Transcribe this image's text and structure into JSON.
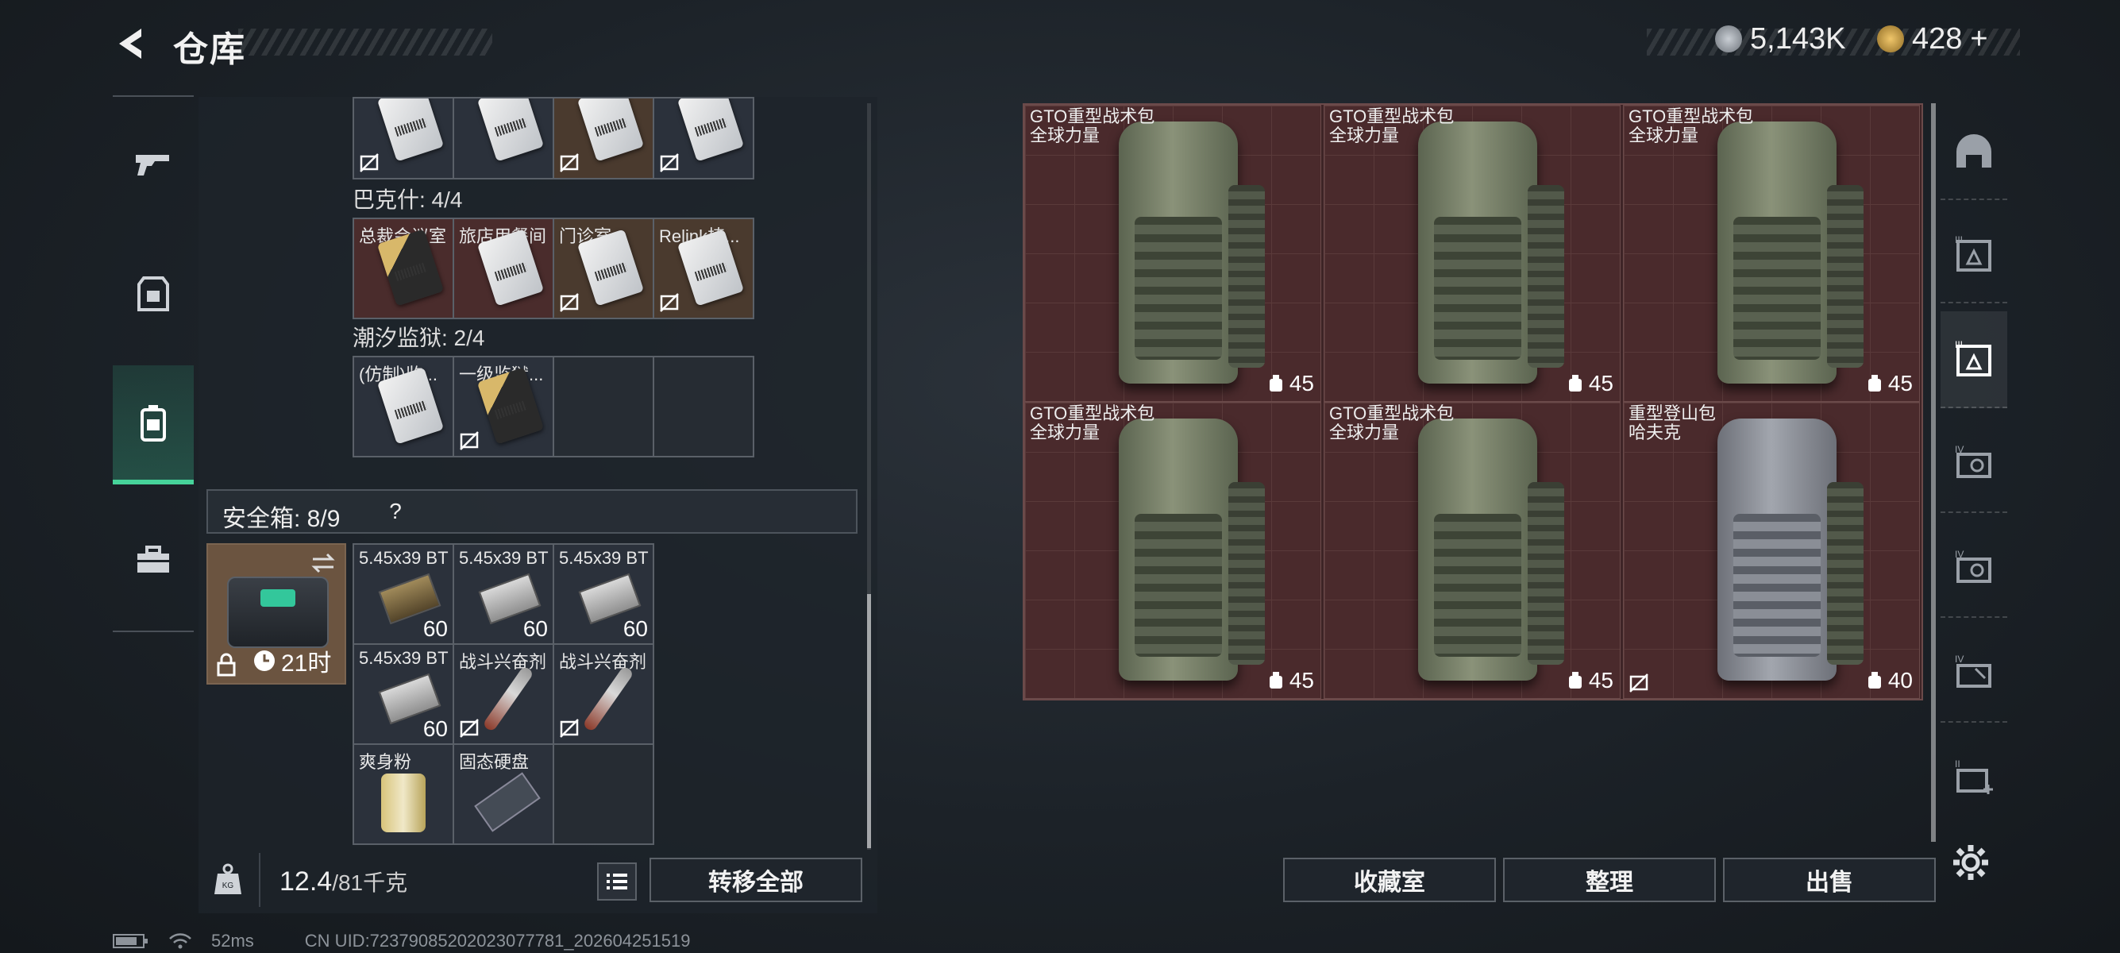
{
  "header": {
    "title": "仓库",
    "currency1_value": "5,143K",
    "currency2_value": "428",
    "currency2_add": "+"
  },
  "left_nav": [
    "gun-icon",
    "vest-icon",
    "backpack-icon",
    "toolbox-icon"
  ],
  "stash": {
    "top_row": [
      "",
      "",
      "",
      ""
    ],
    "bakesh_label": "巴克什: 4/4",
    "bakesh_items": [
      "总裁会议室",
      "旅店用餐间",
      "门诊室",
      "Relink植..."
    ],
    "prison_label": "潮汐监狱: 2/4",
    "prison_items": [
      "(仿制)监...",
      "一级监狱..."
    ]
  },
  "safe": {
    "label": "安全箱: 8/9",
    "help": "?",
    "timer": "21时",
    "items": [
      {
        "name": "5.45x39 BT",
        "qty": "60"
      },
      {
        "name": "5.45x39 BT",
        "qty": "60"
      },
      {
        "name": "5.45x39 BT",
        "qty": "60"
      },
      {
        "name": "5.45x39 BT",
        "qty": "60"
      },
      {
        "name": "战斗兴奋剂",
        "qty": ""
      },
      {
        "name": "战斗兴奋剂",
        "qty": ""
      },
      {
        "name": "爽身粉",
        "qty": ""
      },
      {
        "name": "固态硬盘",
        "qty": ""
      }
    ]
  },
  "bottom_left": {
    "weight_current": "12.4",
    "weight_max": "/81千克",
    "transfer_all": "转移全部"
  },
  "right_items": [
    {
      "name": "GTO重型战术包",
      "brand": "全球力量",
      "capacity": "45"
    },
    {
      "name": "GTO重型战术包",
      "brand": "全球力量",
      "capacity": "45"
    },
    {
      "name": "GTO重型战术包",
      "brand": "全球力量",
      "capacity": "45"
    },
    {
      "name": "GTO重型战术包",
      "brand": "全球力量",
      "capacity": "45"
    },
    {
      "name": "GTO重型战术包",
      "brand": "全球力量",
      "capacity": "45"
    },
    {
      "name": "重型登山包",
      "brand": "哈夫克",
      "capacity": "40"
    }
  ],
  "bottom_right": {
    "collection": "收藏室",
    "sort": "整理",
    "sell": "出售"
  },
  "right_tabs": [
    "helmet-icon",
    "armor-III",
    "armor-III",
    "armor-IV",
    "armor-IV",
    "chest-rig-IV",
    "medkit-II"
  ],
  "status": {
    "ping": "52ms",
    "uid": "CN UID:7237908520202307778​1_202604251519"
  }
}
